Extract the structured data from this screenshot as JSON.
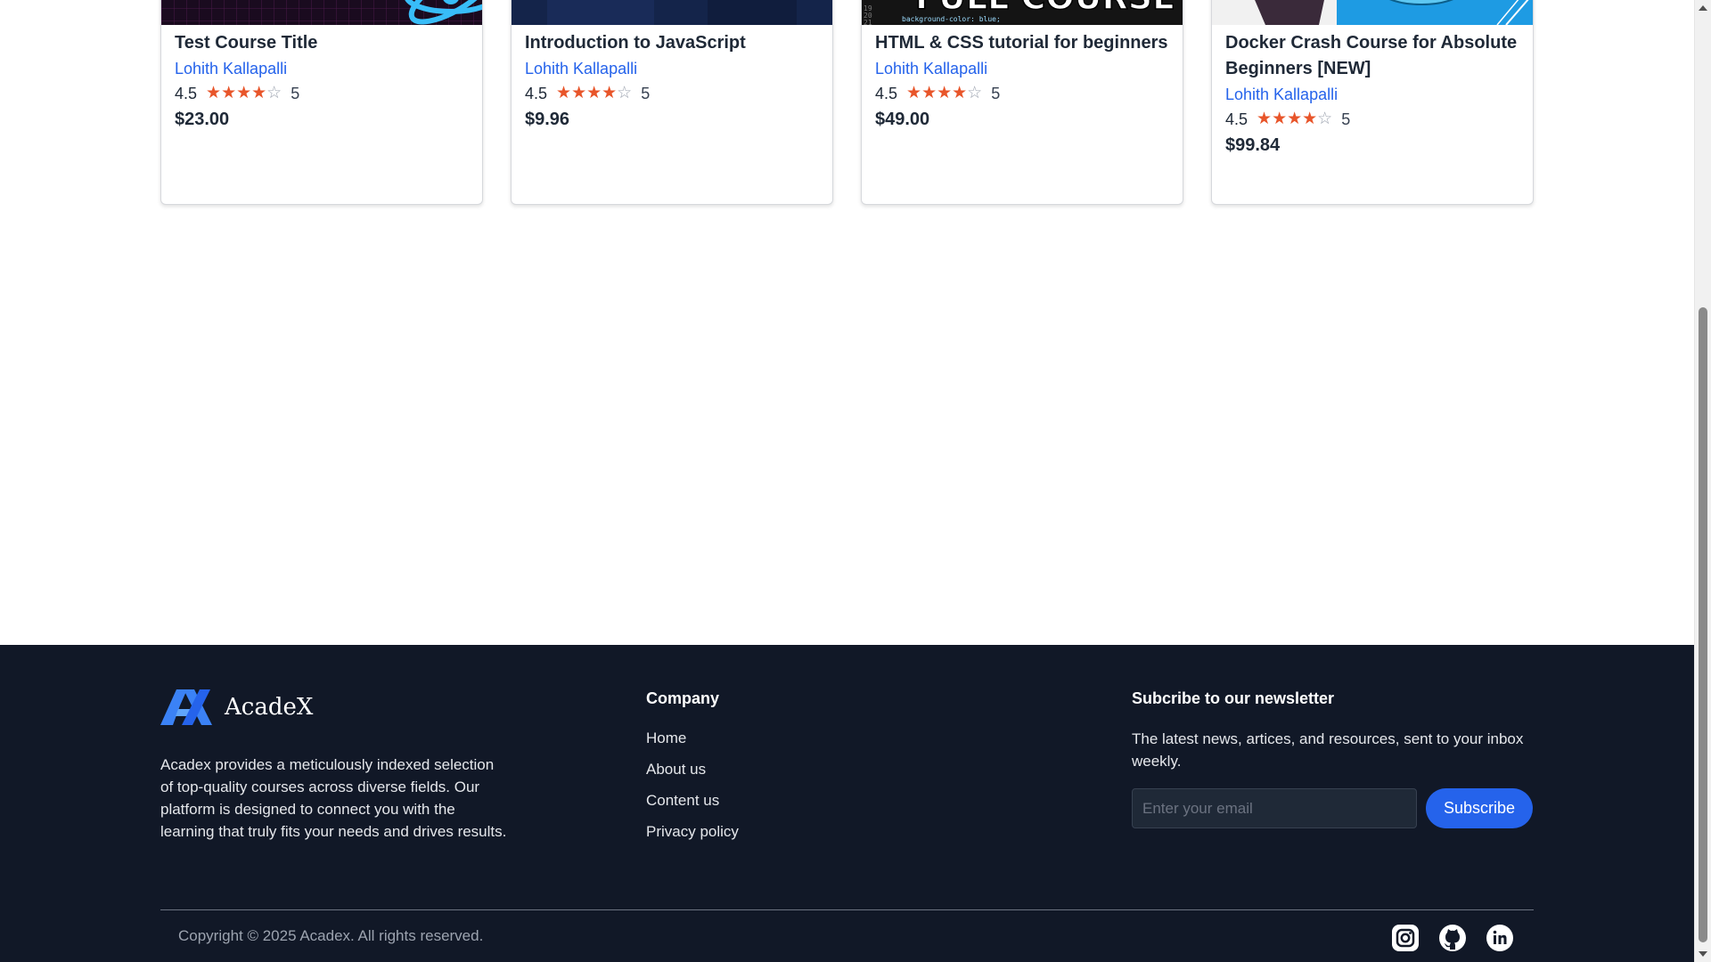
{
  "courses": [
    {
      "title": "Test Course Title",
      "author": "Lohith Kallapalli",
      "rating": "4.5",
      "count": "5",
      "price": "$23.00",
      "rating_value": 4.5
    },
    {
      "title": "Introduction to JavaScript",
      "author": "Lohith Kallapalli",
      "rating": "4.5",
      "count": "5",
      "price": "$9.96",
      "rating_value": 4.5
    },
    {
      "title": "HTML & CSS tutorial for beginners",
      "author": "Lohith Kallapalli",
      "rating": "4.5",
      "count": "5",
      "price": "$49.00",
      "rating_value": 4.5
    },
    {
      "title": "Docker Crash Course for Absolute Beginners [NEW]",
      "author": "Lohith Kallapalli",
      "rating": "4.5",
      "count": "5",
      "price": "$99.84",
      "rating_value": 4.5
    }
  ],
  "thumb_text": {
    "html_banner": "FULL COURSE",
    "html_code": "background-color: blue;"
  },
  "footer": {
    "brand": "AcadeX",
    "about": "Acadex provides a meticulously indexed selection of top-quality courses across diverse fields. Our platform is designed to connect you with the learning that truly fits your needs and drives results.",
    "company_heading": "Company",
    "company_links": [
      "Home",
      "About us",
      "Content us",
      "Privacy policy"
    ],
    "newsletter_heading": "Subcribe to our newsletter",
    "newsletter_desc": "The latest news, artices, and resources, sent to your inbox weekly.",
    "email_placeholder": "Enter your email",
    "subscribe_label": "Subscribe",
    "copyright": "Copyright © 2025 Acadex. All rights reserved.",
    "socials": [
      "instagram-icon",
      "github-icon",
      "linkedin-icon"
    ]
  },
  "colors": {
    "accent": "#2563eb",
    "footer_bg": "#111827",
    "star": "#e8552a"
  }
}
